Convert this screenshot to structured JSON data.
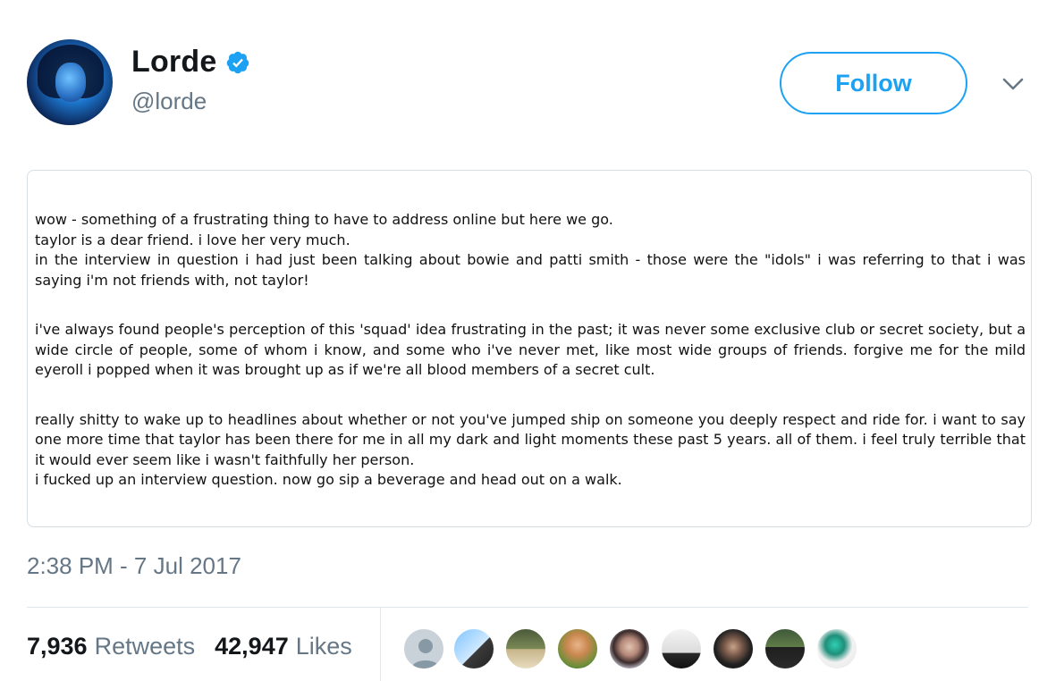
{
  "profile": {
    "display_name": "Lorde",
    "handle": "@lorde",
    "verified": true,
    "avatar_icon": "profile-photo",
    "verified_icon": "verified-badge-icon"
  },
  "follow_label": "Follow",
  "more_icon": "chevron-down-icon",
  "note_paragraphs": [
    [
      "wow - something of a frustrating thing to have to address online but here we go.",
      "taylor is a dear friend. i love her very much.",
      "in the interview in question i had just been talking about bowie and patti smith - those were the \"idols\" i was referring to that i was saying i'm not friends with, not taylor!"
    ],
    [
      "i've always found people's perception of this 'squad' idea frustrating in the past; it was never some exclusive club or secret society, but a wide circle of people, some of whom i know, and some who i've never met, like most wide groups of friends. forgive me for the mild eyeroll i popped when it was brought up as if we're all blood members of a secret cult."
    ],
    [
      "really shitty to wake up to headlines about whether or not you've jumped ship on someone you deeply respect and ride for. i want to say one more time that taylor has been there for me in all my dark and light moments these past 5 years. all of them. i feel truly terrible that it would ever seem like i wasn't faithfully her person.",
      "i fucked up an interview question. now go sip a beverage and head out on a walk."
    ]
  ],
  "timestamp": "2:38 PM - 7 Jul 2017",
  "stats": {
    "retweets_count": "7,936",
    "retweets_label": "Retweets",
    "likes_count": "42,947",
    "likes_label": "Likes"
  },
  "colors": {
    "accent": "#1da1f2",
    "secondary_text": "#657786",
    "primary_text": "#14171a",
    "divider": "#e1e8ed"
  }
}
